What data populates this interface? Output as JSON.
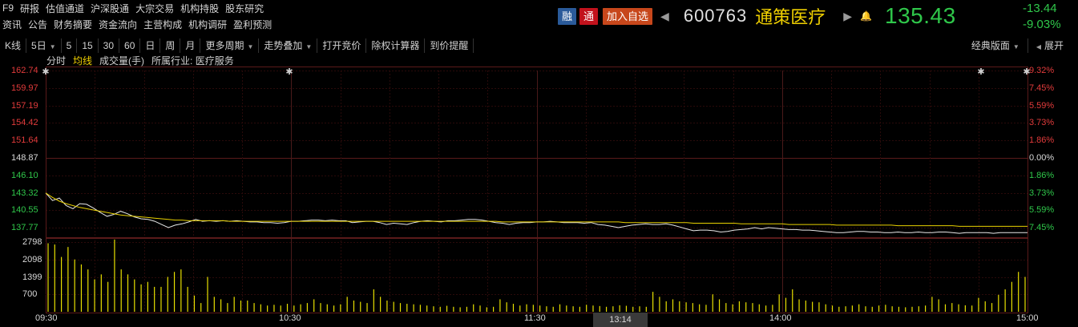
{
  "nav": {
    "row1": [
      "F9",
      "研报",
      "估值通道",
      "沪深股通",
      "大宗交易",
      "机构持股",
      "股东研究"
    ],
    "row2": [
      "资讯",
      "公告",
      "财务摘要",
      "资金流向",
      "主营构成",
      "机构调研",
      "盈利预测"
    ]
  },
  "stock": {
    "tag_rong": "融",
    "tag_tong": "通",
    "add_watchlist": "加入自选",
    "code": "600763",
    "name": "通策医疗",
    "price": "135.43",
    "change": "-13.44",
    "change_pct": "-9.03%",
    "price_color": "#2fc74a",
    "name_color": "#f0d000"
  },
  "toolbar": {
    "kline": "K线",
    "days": "5日",
    "periods": [
      "5",
      "15",
      "30",
      "60",
      "日",
      "周",
      "月"
    ],
    "more_periods": "更多周期",
    "overlay": "走势叠加",
    "auction": "打开竞价",
    "calculator": "除权计算器",
    "price_alert": "到价提醒",
    "layout": "经典版面",
    "expand": "展开"
  },
  "legend": {
    "intraday": "分时",
    "avg_line": "均线",
    "volume": "成交量(手)",
    "industry": "所属行业: 医疗服务"
  },
  "chart_data": {
    "type": "line",
    "prev_close": 148.87,
    "y_ticks_left": [
      "162.74",
      "159.97",
      "157.19",
      "154.42",
      "151.64",
      "148.87",
      "146.10",
      "143.32",
      "140.55",
      "137.77"
    ],
    "y_ticks_right": [
      "9.32%",
      "7.45%",
      "5.59%",
      "3.73%",
      "1.86%",
      "0.00%",
      "1.86%",
      "3.73%",
      "5.59%",
      "7.45%"
    ],
    "ylim": [
      136.4,
      162.74
    ],
    "x_ticks": [
      "09:30",
      "10:30",
      "11:30",
      "14:00",
      "15:00"
    ],
    "cursor_time": "13:14",
    "volume_ticks": [
      "2798",
      "2098",
      "1399",
      "700"
    ],
    "volume_ylim": [
      0,
      2798
    ],
    "series": [
      {
        "name": "分时",
        "color": "#e8e8e8",
        "values": [
          143.3,
          142.1,
          142.5,
          141.3,
          140.8,
          141.6,
          141.5,
          140.9,
          140.2,
          139.6,
          139.9,
          140.4,
          140.0,
          139.5,
          139.2,
          139.1,
          138.8,
          138.3,
          137.8,
          138.2,
          138.4,
          138.7,
          139.1,
          138.8,
          138.9,
          138.8,
          138.9,
          138.8,
          138.9,
          138.8,
          138.7,
          138.7,
          138.6,
          138.6,
          138.5,
          138.6,
          138.8,
          138.8,
          138.9,
          139.0,
          139.0,
          138.9,
          139.0,
          138.9,
          138.9,
          138.6,
          138.7,
          138.8,
          138.8,
          138.6,
          138.3,
          138.5,
          138.4,
          138.3,
          138.6,
          138.8,
          138.9,
          138.8,
          138.7,
          138.9,
          138.9,
          139.0,
          139.1,
          139.1,
          139.0,
          138.8,
          138.6,
          138.5,
          138.3,
          138.5,
          138.6,
          138.6,
          138.7,
          138.7,
          138.8,
          138.7,
          138.6,
          138.6,
          138.6,
          138.5,
          138.6,
          138.3,
          138.2,
          138.0,
          137.8,
          138.0,
          138.2,
          138.3,
          138.4,
          138.3,
          138.3,
          138.4,
          138.2,
          137.9,
          137.6,
          137.3,
          137.4,
          137.4,
          137.3,
          137.1,
          137.2,
          137.4,
          137.5,
          137.6,
          137.8,
          137.6,
          137.8,
          137.7,
          137.6,
          137.5,
          137.5,
          137.4,
          137.4,
          137.3,
          137.2,
          137.1,
          137.0,
          137.0,
          137.1,
          137.2,
          137.2,
          137.1,
          137.1,
          137.0,
          137.0,
          137.1,
          137.0,
          137.0,
          137.1,
          137.0,
          137.0,
          137.1,
          137.1,
          137.0,
          136.9,
          137.0,
          137.0,
          137.0,
          137.0,
          136.9,
          137.0,
          137.0,
          137.0,
          137.0,
          137.0
        ]
      },
      {
        "name": "均线",
        "color": "#e8d000",
        "values": [
          143.3,
          142.6,
          142.0,
          141.6,
          141.3,
          141.0,
          140.8,
          140.6,
          140.4,
          140.2,
          140.0,
          139.8,
          139.7,
          139.6,
          139.5,
          139.4,
          139.3,
          139.2,
          139.1,
          139.0,
          139.0,
          138.9,
          138.9,
          138.9,
          138.9,
          138.9,
          138.9,
          138.8,
          138.8,
          138.8,
          138.8,
          138.8,
          138.8,
          138.8,
          138.8,
          138.8,
          138.8,
          138.8,
          138.8,
          138.8,
          138.8,
          138.8,
          138.8,
          138.8,
          138.8,
          138.8,
          138.8,
          138.8,
          138.8,
          138.8,
          138.8,
          138.8,
          138.8,
          138.8,
          138.8,
          138.8,
          138.8,
          138.8,
          138.8,
          138.8,
          138.8,
          138.8,
          138.8,
          138.8,
          138.8,
          138.8,
          138.8,
          138.7,
          138.7,
          138.7,
          138.7,
          138.7,
          138.7,
          138.7,
          138.7,
          138.7,
          138.7,
          138.7,
          138.7,
          138.7,
          138.7,
          138.7,
          138.7,
          138.7,
          138.7,
          138.6,
          138.6,
          138.6,
          138.6,
          138.6,
          138.6,
          138.6,
          138.6,
          138.6,
          138.6,
          138.5,
          138.5,
          138.5,
          138.5,
          138.5,
          138.5,
          138.5,
          138.4,
          138.4,
          138.4,
          138.4,
          138.4,
          138.4,
          138.4,
          138.3,
          138.3,
          138.3,
          138.3,
          138.3,
          138.3,
          138.3,
          138.2,
          138.2,
          138.2,
          138.2,
          138.2,
          138.2,
          138.2,
          138.2,
          138.2,
          138.1,
          138.1,
          138.1,
          138.1,
          138.1,
          138.1,
          138.1,
          138.1,
          138.1,
          138.0,
          138.0,
          138.0,
          138.0,
          138.0,
          138.0,
          138.0,
          138.0,
          138.0,
          138.0,
          138.0
        ]
      }
    ],
    "volume": [
      2750,
      2700,
      2200,
      2600,
      2100,
      1900,
      1700,
      1300,
      1500,
      1200,
      2900,
      1700,
      1500,
      1300,
      1100,
      1200,
      1000,
      1000,
      1400,
      1600,
      1700,
      1000,
      650,
      350,
      1400,
      600,
      500,
      350,
      600,
      450,
      450,
      350,
      300,
      250,
      280,
      250,
      320,
      250,
      300,
      350,
      500,
      350,
      300,
      250,
      300,
      600,
      450,
      400,
      350,
      900,
      600,
      450,
      400,
      350,
      320,
      300,
      280,
      250,
      220,
      200,
      240,
      200,
      180,
      200,
      300,
      250,
      180,
      200,
      500,
      380,
      320,
      250,
      300,
      280,
      250,
      220,
      200,
      300,
      250,
      220,
      200,
      280,
      250,
      230,
      200,
      220,
      260,
      240,
      200,
      220,
      200,
      800,
      600,
      420,
      500,
      420,
      380,
      350,
      300,
      280,
      700,
      500,
      350,
      300,
      420,
      380,
      350,
      300,
      250,
      280,
      700,
      560,
      900,
      500,
      450,
      400,
      380,
      300,
      250,
      200,
      220,
      250,
      300,
      220,
      200,
      250,
      280,
      220,
      200,
      180,
      200,
      220,
      250,
      600,
      500,
      300,
      350,
      300,
      260,
      250,
      560,
      420,
      350,
      680,
      900,
      1200,
      1600,
      1400
    ]
  }
}
